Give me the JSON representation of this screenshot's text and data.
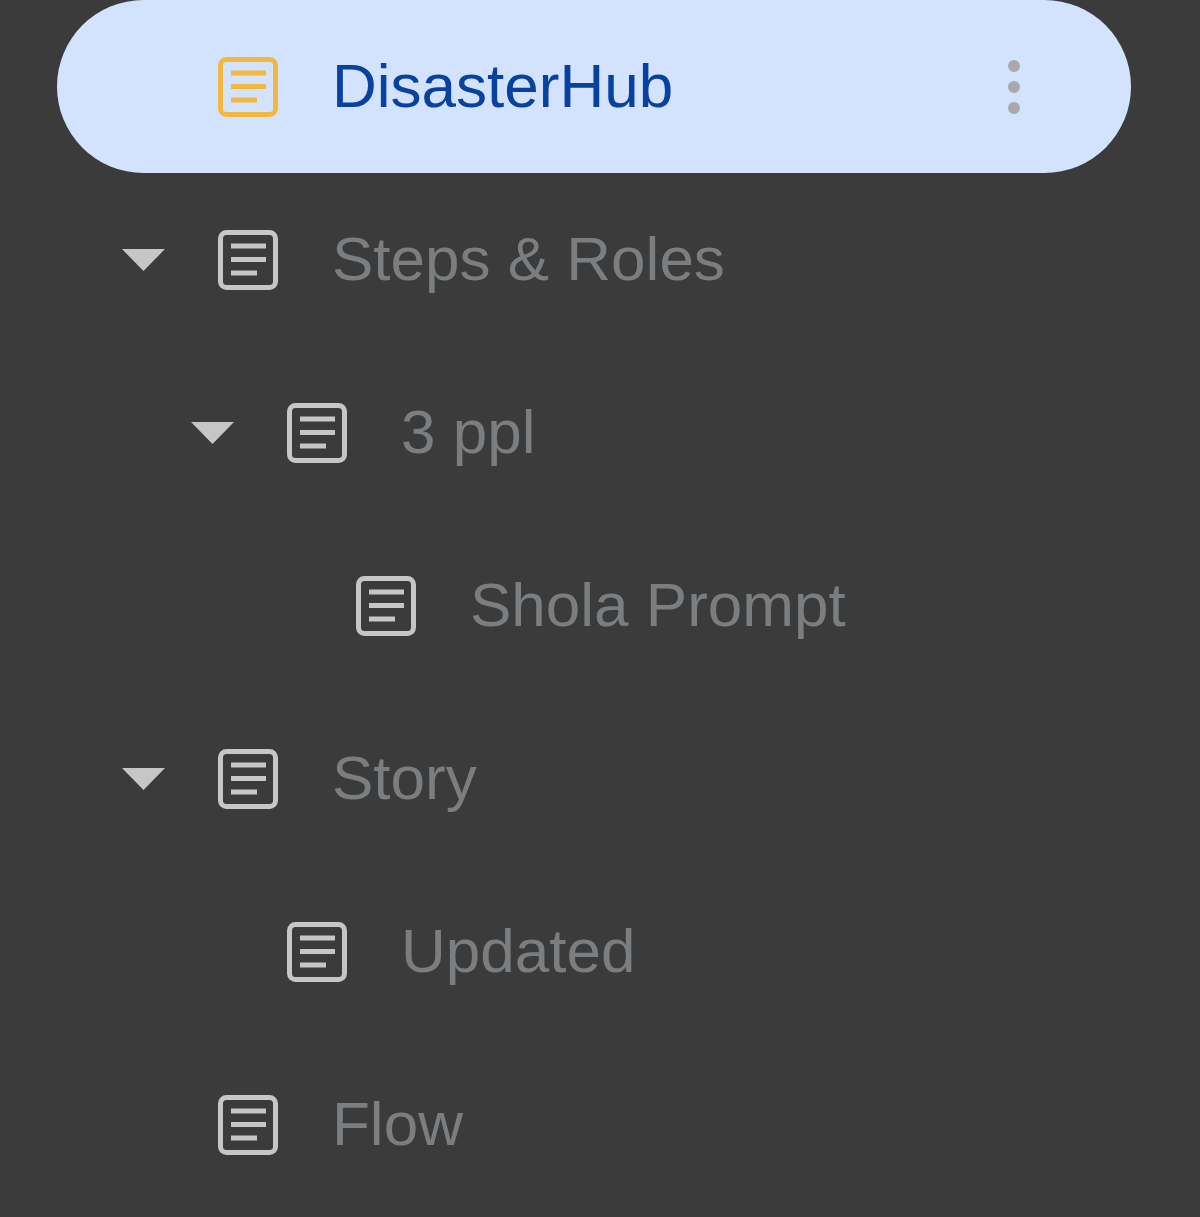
{
  "document_tabs": [
    {
      "title": "DisasterHub",
      "selected": true
    },
    {
      "title": "Steps & Roles",
      "selected": false,
      "expanded": true,
      "children": [
        {
          "title": "3 ppl",
          "selected": false,
          "expanded": true,
          "children": [
            {
              "title": "Shola Prompt",
              "selected": false
            }
          ]
        }
      ]
    },
    {
      "title": "Story",
      "selected": false,
      "expanded": true,
      "children": [
        {
          "title": "Updated",
          "selected": false
        }
      ]
    },
    {
      "title": "Flow",
      "selected": false
    }
  ]
}
